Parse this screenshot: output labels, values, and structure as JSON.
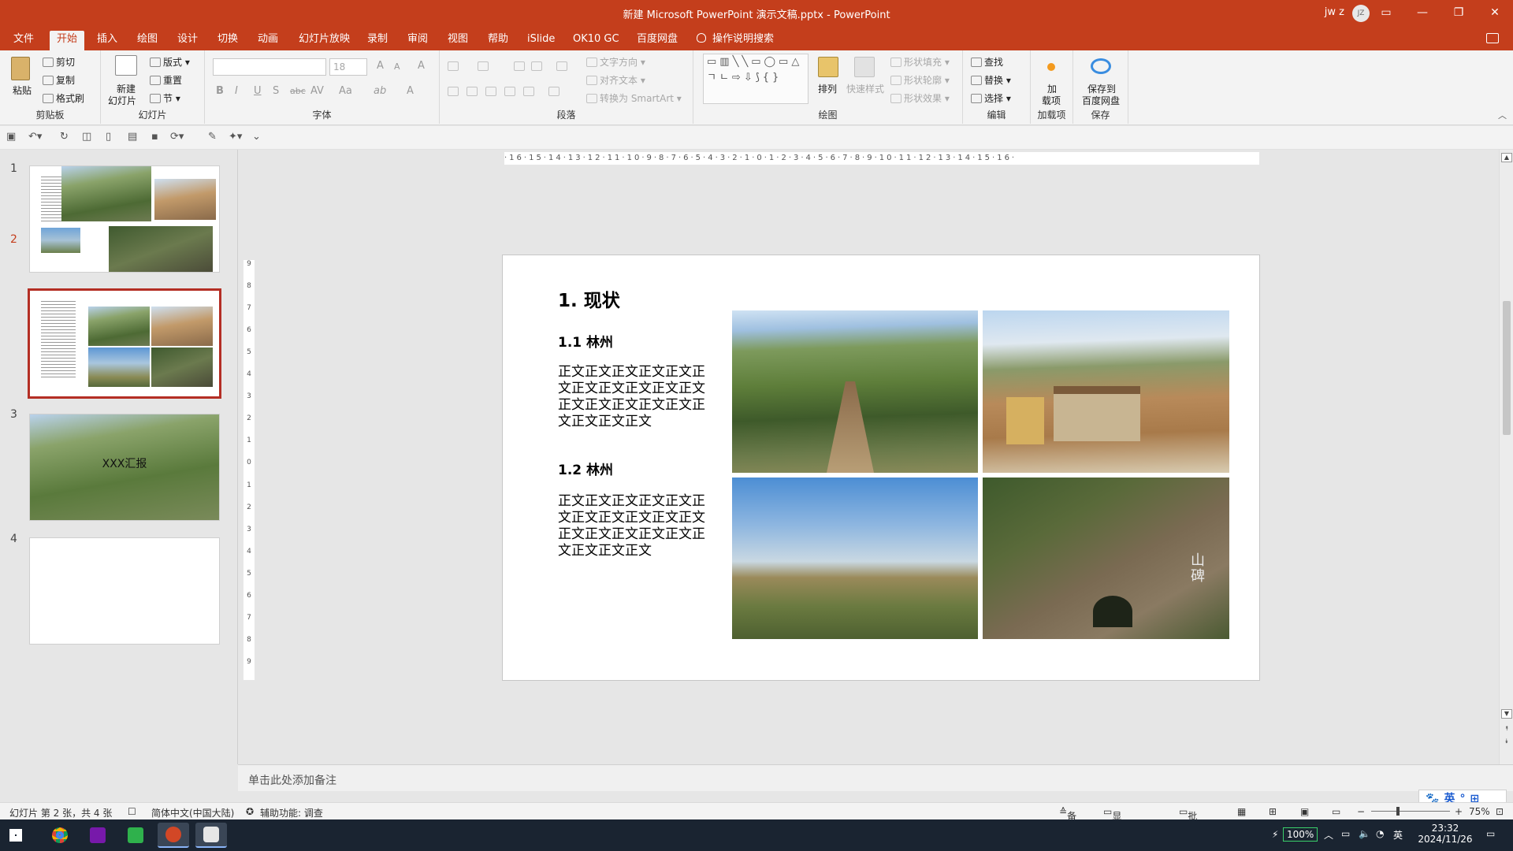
{
  "window": {
    "title": "新建 Microsoft PowerPoint 演示文稿.pptx - PowerPoint",
    "user_name": "jw z",
    "user_initials": "JZ",
    "minimize": "—",
    "restore": "❐",
    "close": "✕",
    "ribbon_display": "▭"
  },
  "tabs": [
    "文件",
    "开始",
    "插入",
    "绘图",
    "设计",
    "切换",
    "动画",
    "幻灯片放映",
    "录制",
    "审阅",
    "视图",
    "帮助",
    "iSlide",
    "OK10 GC",
    "百度网盘"
  ],
  "tell_me": "操作说明搜索",
  "ribbon": {
    "clipboard": {
      "label": "剪贴板",
      "paste": "粘贴",
      "cut": "剪切",
      "copy": "复制",
      "format_painter": "格式刷"
    },
    "slides": {
      "label": "幻灯片",
      "new_slide": "新建",
      "new_slide_2": "幻灯片",
      "layout": "版式",
      "reset": "重置",
      "section": "节"
    },
    "font": {
      "label": "字体",
      "font_size": "18",
      "bold": "B",
      "italic": "I",
      "underline": "U",
      "shadow": "S",
      "strike": "abc",
      "spacing": "AV",
      "case": "Aa",
      "grow": "A",
      "shrink": "A",
      "clear": "A",
      "highlight": "ab",
      "color": "A"
    },
    "paragraph": {
      "label": "段落",
      "text_direction": "文字方向",
      "align_text": "对齐文本",
      "smartart": "转换为 SmartArt"
    },
    "drawing": {
      "label": "绘图",
      "arrange": "排列",
      "quick_styles": "快速样式",
      "fill": "形状填充",
      "outline": "形状轮廓",
      "effects": "形状效果",
      "shapes": "▭▥╲╲▭◯▭△ㄱㄴ⇨⇩⟆{}"
    },
    "editing": {
      "label": "编辑",
      "find": "查找",
      "replace": "替换",
      "select": "选择"
    },
    "addins": {
      "label": "加载项",
      "btn": "加",
      "btn_2": "载项"
    },
    "save": {
      "label": "保存",
      "btn": "保存到",
      "btn_2": "百度网盘"
    }
  },
  "thumbnails": [
    {
      "num": "1",
      "text": ""
    },
    {
      "num": "2",
      "text": ""
    },
    {
      "num": "3",
      "text": "XXX汇报"
    },
    {
      "num": "4",
      "text": ""
    }
  ],
  "slide": {
    "title": "1. 现状",
    "section1": "1.1 林州",
    "body1": "正文正文正文正文正文正文正文正文正文正文正文正文正文正文正文正文正文正文正文正文",
    "section2": "1.2 林州",
    "body2": "正文正文正文正文正文正文正文正文正文正文正文正文正文正文正文正文正文正文正文正文",
    "rock_text": "山碑"
  },
  "ruler_h": "·16·15·14·13·12·11·10·9·8·7·6·5·4·3·2·1·0·1·2·3·4·5·6·7·8·9·10·11·12·13·14·15·16·",
  "ruler_v": [
    "9",
    "8",
    "7",
    "6",
    "5",
    "4",
    "3",
    "2",
    "1",
    "0",
    "1",
    "2",
    "3",
    "4",
    "5",
    "6",
    "7",
    "8",
    "9"
  ],
  "notes_placeholder": "单击此处添加备注",
  "status": {
    "slide_info": "幻灯片 第 2 张，共 4 张",
    "language": "简体中文(中国大陆)",
    "accessibility": "辅助功能: 调查",
    "notes": "备注",
    "display_settings": "显示器设置",
    "comments": "批注",
    "zoom": "75%"
  },
  "ime": "英",
  "taskbar": {
    "battery": "100%",
    "ime_lang": "英",
    "time": "23:32",
    "date": "2024/11/26"
  },
  "colors": {
    "accent": "#c43e1c",
    "selection": "#b42e24"
  }
}
